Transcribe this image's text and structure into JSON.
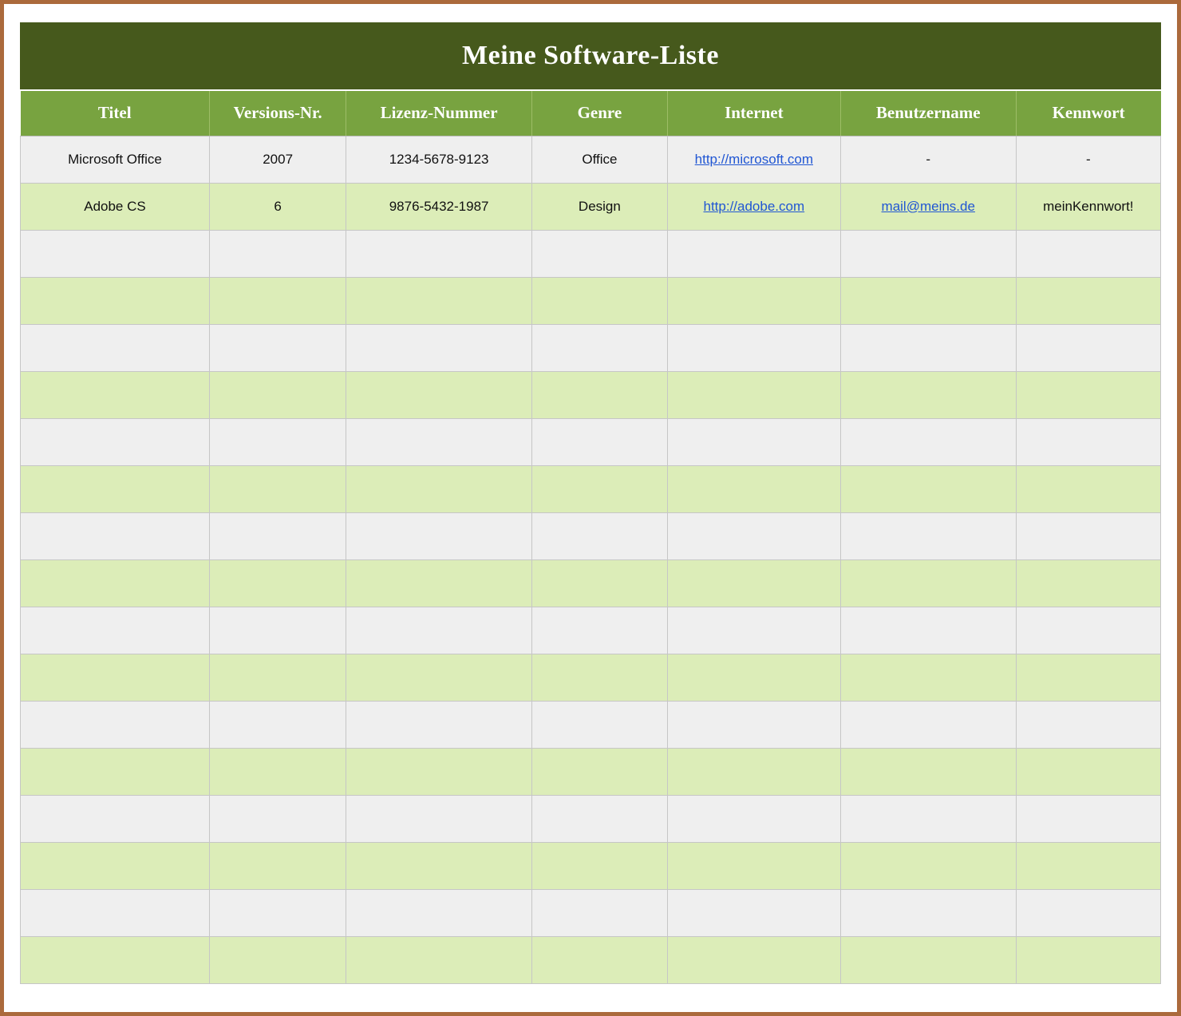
{
  "title": "Meine Software-Liste",
  "table": {
    "headers": [
      "Titel",
      "Versions-Nr.",
      "Lizenz-Nummer",
      "Genre",
      "Internet",
      "Benutzername",
      "Kennwort"
    ],
    "col_widths_pct": [
      16.6,
      12.0,
      16.3,
      11.9,
      15.2,
      15.4,
      12.7
    ],
    "rows": [
      {
        "cells": [
          {
            "text": "Microsoft Office"
          },
          {
            "text": "2007"
          },
          {
            "text": "1234-5678-9123"
          },
          {
            "text": "Office"
          },
          {
            "text": "http://microsoft.com",
            "link": true
          },
          {
            "text": "-"
          },
          {
            "text": "-"
          }
        ]
      },
      {
        "cells": [
          {
            "text": "Adobe CS"
          },
          {
            "text": "6"
          },
          {
            "text": "9876-5432-1987"
          },
          {
            "text": "Design"
          },
          {
            "text": "http://adobe.com",
            "link": true
          },
          {
            "text": "mail@meins.de",
            "link": true
          },
          {
            "text": "meinKennwort!"
          }
        ]
      }
    ],
    "empty_rows": 16
  },
  "colors": {
    "frame_border": "#ab6a3c",
    "title_bg": "#46591c",
    "header_bg": "#78a340",
    "row_gray": "#efefef",
    "row_green": "#dcedb8",
    "grid": "#c6c6c6",
    "link": "#2056d3"
  }
}
